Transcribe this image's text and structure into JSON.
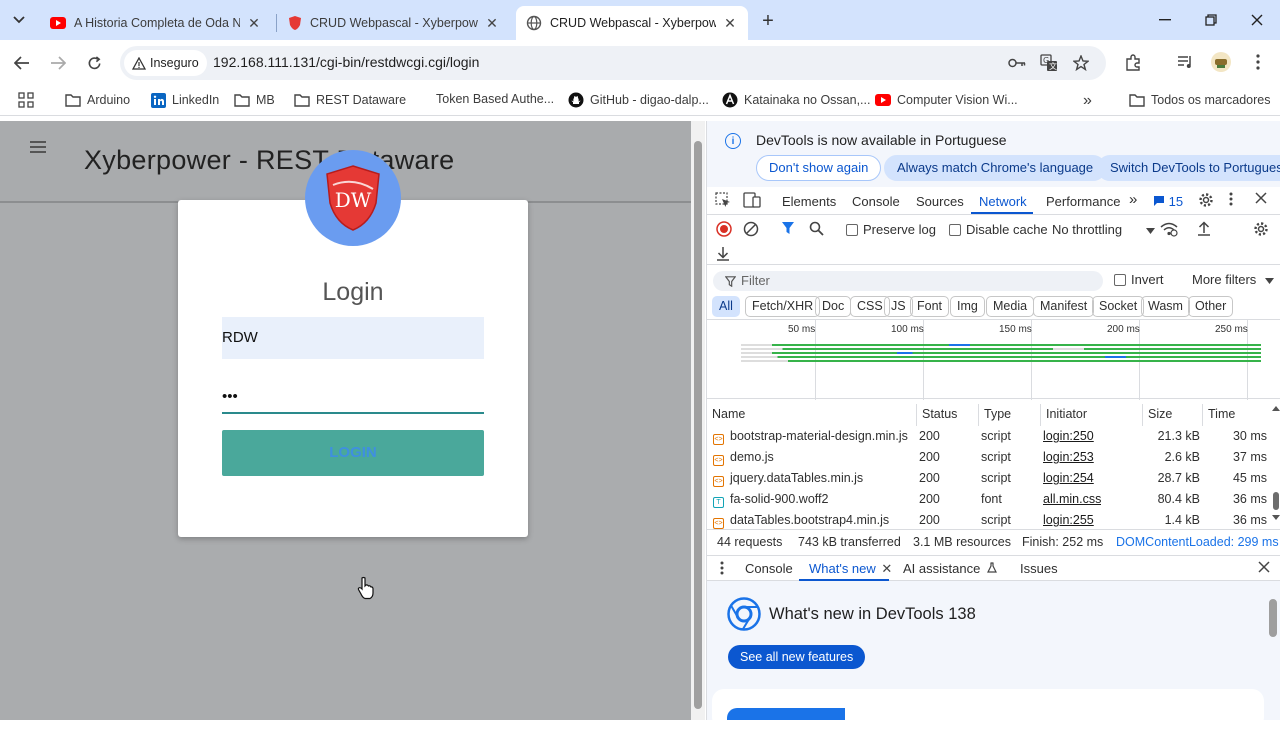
{
  "browser": {
    "tabs": [
      {
        "title": "A Historia Completa de Oda No",
        "icon": "youtube-icon"
      },
      {
        "title": "CRUD Webpascal - Xyberpower",
        "icon": "shield-icon"
      },
      {
        "title": "CRUD Webpascal - Xyberpower",
        "icon": "globe-icon",
        "active": true
      }
    ],
    "security_label": "Inseguro",
    "url": "192.168.111.131/cgi-bin/restdwcgi.cgi/login",
    "bookmarks": [
      {
        "label": "Arduino",
        "icon": "folder-icon"
      },
      {
        "label": "LinkedIn",
        "icon": "linkedin-icon"
      },
      {
        "label": "MB",
        "icon": "folder-icon"
      },
      {
        "label": "REST Dataware",
        "icon": "folder-icon"
      },
      {
        "label": "Token Based Authe...",
        "icon": "none"
      },
      {
        "label": "GitHub - digao-dalp...",
        "icon": "github-icon"
      },
      {
        "label": "Katainaka no Ossan,...",
        "icon": "a-icon"
      },
      {
        "label": "Computer Vision Wi...",
        "icon": "youtube-icon"
      }
    ],
    "more_bookmarks": "»",
    "all_bookmarks": "Todos os marcadores"
  },
  "page": {
    "title": "Xyberpower - REST Dataware",
    "logo_text": "DW",
    "login_title": "Login",
    "username": "RDW",
    "password": "•••",
    "login_button": "LOGIN"
  },
  "devtools": {
    "info_text": "DevTools is now available in Portuguese",
    "info_buttons": [
      "Don't show again",
      "Always match Chrome's language",
      "Switch DevTools to Portuguese"
    ],
    "tabs": [
      "Elements",
      "Console",
      "Sources",
      "Network",
      "Performance"
    ],
    "active_tab": "Network",
    "more_tabs": "»",
    "issues_count": "15",
    "preserve_log": "Preserve log",
    "disable_cache": "Disable cache",
    "throttling": "No throttling",
    "filter_placeholder": "Filter",
    "invert": "Invert",
    "more_filters": "More filters",
    "chips": [
      "All",
      "Fetch/XHR",
      "Doc",
      "CSS",
      "JS",
      "Font",
      "Img",
      "Media",
      "Manifest",
      "Socket",
      "Wasm",
      "Other"
    ],
    "timeline_labels": [
      "50 ms",
      "100 ms",
      "150 ms",
      "200 ms",
      "250 ms"
    ],
    "columns": [
      "Name",
      "Status",
      "Type",
      "Initiator",
      "Size",
      "Time"
    ],
    "rows": [
      {
        "name": "bootstrap-material-design.min.js",
        "status": "200",
        "type": "script",
        "initiator": "login:250",
        "size": "21.3 kB",
        "time": "30 ms",
        "kind": "script"
      },
      {
        "name": "demo.js",
        "status": "200",
        "type": "script",
        "initiator": "login:253",
        "size": "2.6 kB",
        "time": "37 ms",
        "kind": "script"
      },
      {
        "name": "jquery.dataTables.min.js",
        "status": "200",
        "type": "script",
        "initiator": "login:254",
        "size": "28.7 kB",
        "time": "45 ms",
        "kind": "script"
      },
      {
        "name": "fa-solid-900.woff2",
        "status": "200",
        "type": "font",
        "initiator": "all.min.css",
        "size": "80.4 kB",
        "time": "36 ms",
        "kind": "font"
      },
      {
        "name": "dataTables.bootstrap4.min.js",
        "status": "200",
        "type": "script",
        "initiator": "login:255",
        "size": "1.4 kB",
        "time": "36 ms",
        "kind": "script"
      }
    ],
    "summary": {
      "requests": "44 requests",
      "transferred": "743 kB transferred",
      "resources": "3.1 MB resources",
      "finish": "Finish: 252 ms",
      "dom_loaded": "DOMContentLoaded: 299 ms"
    },
    "drawer_tabs": [
      "Console",
      "What's new",
      "AI assistance",
      "Issues"
    ],
    "whats_new_title": "What's new in DevTools 138",
    "whats_new_button": "See all new features"
  },
  "colors": {
    "accent": "#0b57d0",
    "login_button": "#4aa89b",
    "avatar": "#6a9cf0",
    "shield": "#e53935"
  }
}
